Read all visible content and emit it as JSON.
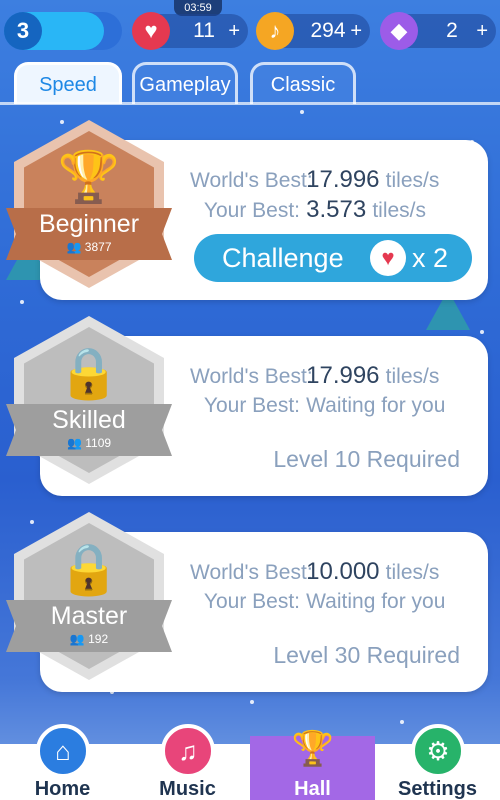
{
  "status": {
    "clock": "03:59",
    "level": "3",
    "level_progress": 0.85,
    "lives": "11",
    "notes": "294",
    "gems": "2",
    "plus": "+"
  },
  "tabs": [
    {
      "label": "Speed",
      "active": true
    },
    {
      "label": "Gameplay",
      "active": false
    },
    {
      "label": "Classic",
      "active": false
    }
  ],
  "labels": {
    "worlds_best": "World's Best:",
    "your_best": "Your Best:",
    "unit": "tiles/s"
  },
  "cards": [
    {
      "badge_name": "Beginner",
      "player_count": "3877",
      "worlds_best": "17.996",
      "your_best": "3.573",
      "your_best_unit": "tiles/s",
      "challenge_label": "Challenge",
      "challenge_cost": "x 2"
    },
    {
      "badge_name": "Skilled",
      "player_count": "1109",
      "worlds_best": "17.996",
      "your_best": "Waiting for you",
      "requirement": "Level 10 Required"
    },
    {
      "badge_name": "Master",
      "player_count": "192",
      "worlds_best": "10.000",
      "your_best": "Waiting for you",
      "requirement": "Level 30 Required"
    }
  ],
  "nav": [
    {
      "label": "Home",
      "icon": "home-icon",
      "color": "#2b7de0"
    },
    {
      "label": "Music",
      "icon": "music-icon",
      "color": "#e8457a"
    },
    {
      "label": "Hall",
      "icon": "trophy-icon",
      "color": "#a368e6"
    },
    {
      "label": "Settings",
      "icon": "gear-icon",
      "color": "#27b36a"
    }
  ],
  "colors": {
    "bronze": "#c9825c",
    "locked": "#bdbdbd",
    "challenge": "#2fa6dc",
    "heart": "#e53950",
    "note": "#f5a623",
    "gem": "#9c5ce8"
  }
}
